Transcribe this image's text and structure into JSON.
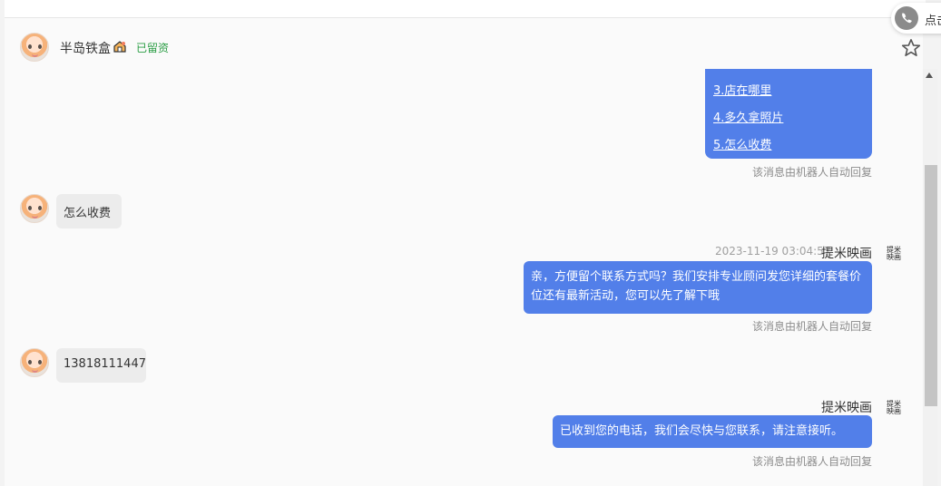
{
  "header": {
    "customer_name": "半岛铁盒",
    "status_tag": "已留资",
    "call_label": "点击"
  },
  "menu": {
    "items": [
      "3.店在哪里",
      "4.多久拿照片",
      "5.怎么收费"
    ]
  },
  "messages": {
    "user_1": "怎么收费",
    "user_2": "13818111447",
    "timestamp_1": "2023-11-19 03:04:57",
    "agent_name": "提米映画",
    "logo_text": "提米映画",
    "bot_1": "亲，方便留个联系方式吗？我们安排专业顾问发您详细的套餐价位还有最新活动，您可以先了解下哦",
    "bot_2": "已收到您的电话，我们会尽快与您联系，请注意接听。",
    "auto_reply_note": "该消息由机器人自动回复"
  },
  "colors": {
    "accent": "#527fe9",
    "status": "#2a9d44",
    "background": "#fafafa"
  },
  "icons": {
    "customer": "customer-avatar",
    "house": "house-icon",
    "star": "star-icon",
    "phone": "phone-icon"
  }
}
